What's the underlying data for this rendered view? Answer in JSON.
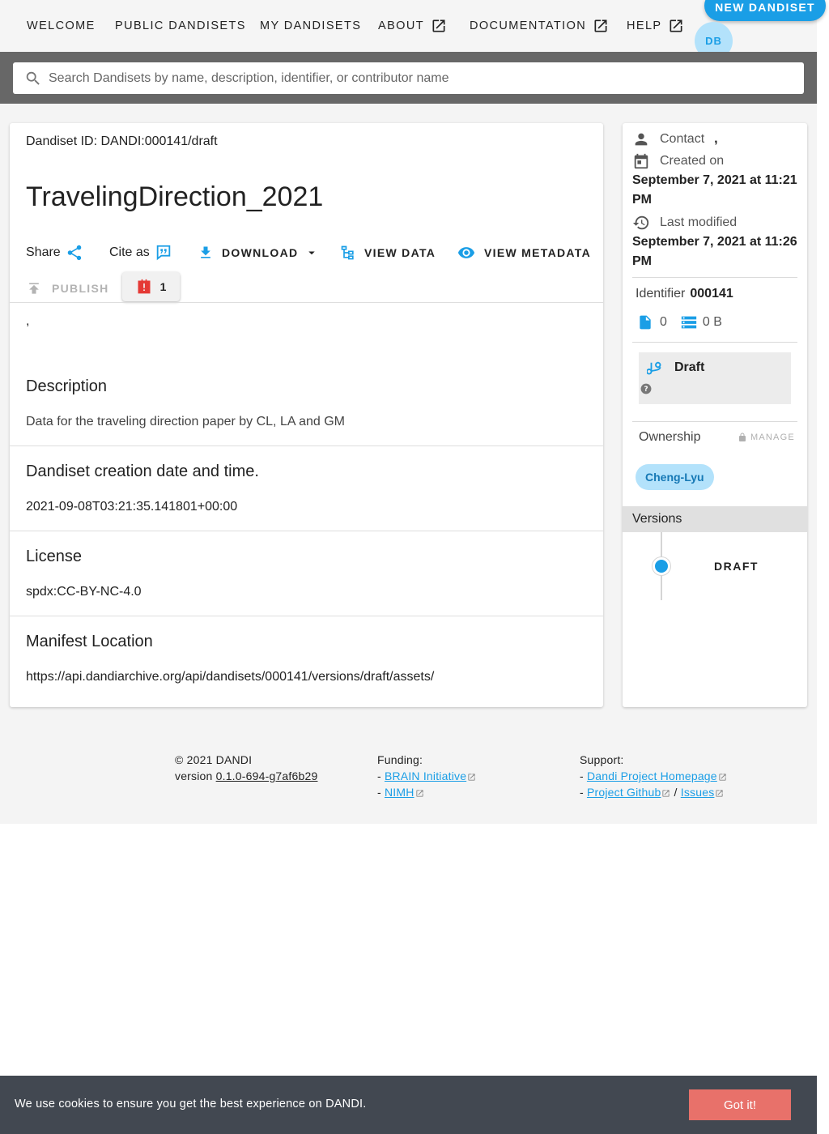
{
  "nav": {
    "welcome": "WELCOME",
    "public_dandisets": "PUBLIC DANDISETS",
    "my_dandisets": "MY DANDISETS",
    "about": "ABOUT",
    "documentation": "DOCUMENTATION",
    "help": "HELP",
    "new_dandiset": "NEW DANDISET",
    "avatar_initials": "DB"
  },
  "search": {
    "placeholder": "Search Dandisets by name, description, identifier, or contributor name"
  },
  "dandiset": {
    "id_line": "Dandiset ID: DANDI:000141/draft",
    "title": "TravelingDirection_2021",
    "share_label": "Share",
    "cite_label": "Cite as",
    "download_label": "DOWNLOAD",
    "view_data_label": "VIEW DATA",
    "view_metadata_label": "VIEW METADATA",
    "publish_label": "PUBLISH",
    "issue_count": "1",
    "contributors_text": ",",
    "sections": [
      {
        "title": "Description",
        "body": "Data for the traveling direction paper by CL, LA and GM"
      },
      {
        "title": "Dandiset creation date and time.",
        "body": "2021-09-08T03:21:35.141801+00:00"
      },
      {
        "title": "License",
        "body": "spdx:CC-BY-NC-4.0"
      },
      {
        "title": "Manifest Location",
        "body": "https://api.dandiarchive.org/api/dandisets/000141/versions/draft/assets/"
      }
    ]
  },
  "side": {
    "contact_label": "Contact",
    "contact_value": ",",
    "created_label": "Created on",
    "created_value": "September 7, 2021 at 11:21 PM",
    "modified_label": "Last modified",
    "modified_value": "September 7, 2021 at 11:26 PM",
    "identifier_label": "Identifier",
    "identifier_value": "000141",
    "file_count": "0",
    "size": "0 B",
    "version_status": "Draft",
    "ownership_label": "Ownership",
    "manage_label": "MANAGE",
    "owner": "Cheng-Lyu",
    "versions_label": "Versions",
    "version_item": "DRAFT"
  },
  "footer": {
    "copyright": "© 2021 DANDI",
    "version_prefix": "version",
    "version": "0.1.0-694-g7af6b29",
    "funding_label": "Funding:",
    "funding_links": [
      "BRAIN Initiative",
      "NIMH"
    ],
    "support_label": "Support:",
    "support_links": [
      "Dandi Project Homepage",
      "Project Github",
      "Issues"
    ]
  },
  "cookie": {
    "text": "We use cookies to ensure you get the best experience on DANDI.",
    "button": "Got it!"
  },
  "colors": {
    "accent": "#1a9ee6",
    "chip_bg": "#b3e2fb",
    "cookie_bg": "#424851",
    "cookie_btn": "#e8716a",
    "issue_red": "#e53935"
  },
  "icons": [
    "open-in-new-icon",
    "search-icon",
    "share-icon",
    "cite-icon",
    "download-icon",
    "caret-down-icon",
    "view-data-icon",
    "eye-icon",
    "publish-icon",
    "alert-icon",
    "person-icon",
    "calendar-icon",
    "history-icon",
    "file-icon",
    "storage-icon",
    "branch-icon",
    "help-icon",
    "lock-icon"
  ]
}
